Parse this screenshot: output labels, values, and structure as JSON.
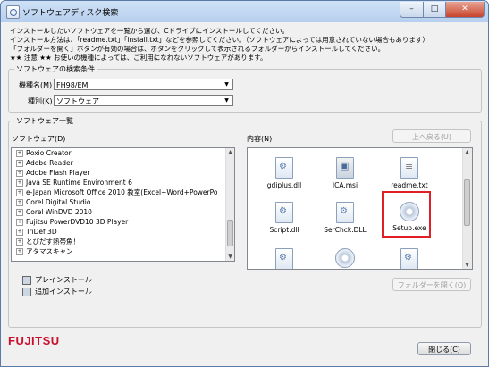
{
  "window": {
    "title": "ソフトウェアディスク検索",
    "controls": {
      "minimize": "–",
      "maximize": "□",
      "close": "✕"
    }
  },
  "intro": [
    "インストールしたいソフトウェアを一覧から選び、Cドライブにインストールしてください。",
    "インストール方法は、「readme.txt」「install.txt」などを参照してください。（ソフトウェアによっては用意されていない場合もあります）",
    "「フォルダーを開く」ボタンが有効の場合は、ボタンをクリックして表示されるフォルダーからインストールしてください。",
    "★★ 注意 ★★ お使いの機種によっては、ご利用になれないソフトウェアがあります。"
  ],
  "search": {
    "legend": "ソフトウェアの検索条件",
    "model_label": "機種名(M)",
    "model_value": "FH98/EM",
    "type_label": "種別(K)",
    "type_value": "ソフトウェア"
  },
  "software_list": {
    "legend": "ソフトウェア一覧",
    "tree_label": "ソフトウェア(D)",
    "contents_label": "内容(N)",
    "up_button": "上へ戻る(U)",
    "open_folder_button": "フォルダーを開く(O)",
    "items": [
      "Roxio Creator",
      "Adobe Reader",
      "Adobe Flash Player",
      "Java SE Runtime Environment 6",
      "e-Japan Microsoft Office 2010 教室(Excel+Word+PowerPo",
      "Corel Digital Studio",
      "Corel WinDVD 2010",
      "Fujitsu PowerDVD10 3D Player",
      "TriDef 3D",
      "とびだす熱帯魚！",
      "アタマスキャン"
    ],
    "install_options": [
      "プレインストール",
      "追加インストール"
    ],
    "files": [
      {
        "name": "gdiplus.dll",
        "icon": "gear-file-icon"
      },
      {
        "name": "ICA.msi",
        "icon": "msi-package-icon"
      },
      {
        "name": "readme.txt",
        "icon": "text-file-icon"
      },
      {
        "name": "Script.dll",
        "icon": "gear-file-icon"
      },
      {
        "name": "SerChck.DLL",
        "icon": "gear-file-icon"
      },
      {
        "name": "Setup.exe",
        "icon": "cd-setup-icon"
      },
      {
        "name": "",
        "icon": "gear-file-icon"
      },
      {
        "name": "",
        "icon": "cd-setup-icon"
      },
      {
        "name": "",
        "icon": "gear-file-icon"
      }
    ]
  },
  "footer": {
    "brand": "FUJITSU",
    "close_button": "閉じる(C)"
  },
  "colors": {
    "highlight": "#e01f26",
    "brand": "#c8102e"
  }
}
